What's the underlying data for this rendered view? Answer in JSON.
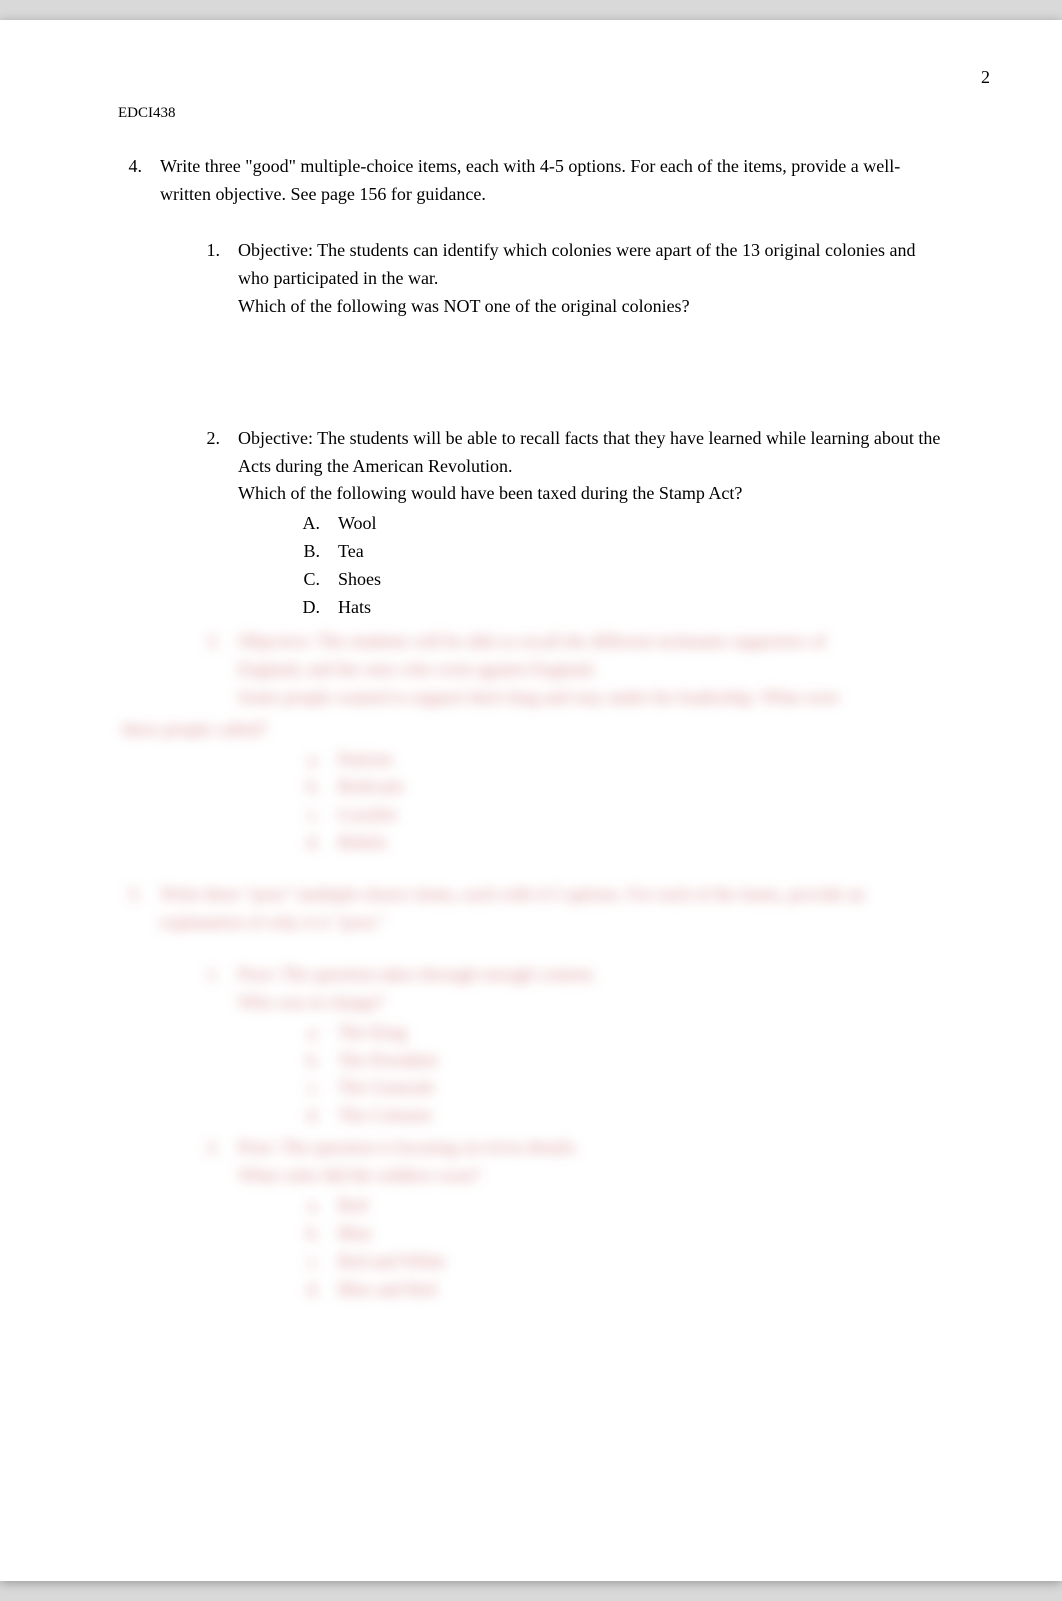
{
  "page_number": "2",
  "header_code": "EDCI438",
  "q4": {
    "number": "4.",
    "prompt": "Write three \"good\" multiple-choice items, each with 4-5 options. For each of the items, provide a well-written objective. See page 156 for guidance.",
    "items": [
      {
        "number": "1.",
        "objective": "Objective: The students can identify which colonies were apart of the 13 original colonies and who participated in the war.",
        "question": "Which of the following was NOT one of the original colonies?",
        "options": []
      },
      {
        "number": "2.",
        "objective": "Objective: The students will be able to recall facts that they have learned while learning about the Acts during the American Revolution.",
        "question": "Which of the following would have been taxed during the Stamp Act?",
        "options": [
          {
            "letter": "A.",
            "text": "Wool"
          },
          {
            "letter": "B.",
            "text": "Tea"
          },
          {
            "letter": "C.",
            "text": "Shoes"
          },
          {
            "letter": "D.",
            "text": "Hats"
          }
        ]
      }
    ],
    "blurred_item": {
      "number": "3.",
      "lines": [
        "Objective: The students will be able to recall the different nickname supporters of",
        "England, and the ones who went against England.",
        "    Some people wanted to support their king and stay under his leadership. What were"
      ],
      "hanging": "these people called?",
      "options": [
        {
          "letter": "a.",
          "text": "Patriots"
        },
        {
          "letter": "b.",
          "text": "Redcoats"
        },
        {
          "letter": "c.",
          "text": "Loyalist"
        },
        {
          "letter": "d.",
          "text": "Rebels"
        }
      ]
    }
  },
  "q5_blurred": {
    "number": "5.",
    "prompt": "Write three \"poor\" multiple-choice items, each with 4-5 options. For each of the items, provide an explanation of why it is \"poor.\"",
    "items": [
      {
        "number": "1.",
        "line1": "Poor: The question takes through enough content.",
        "line2": "Who was in charge?",
        "options": [
          {
            "letter": "a.",
            "text": "The King"
          },
          {
            "letter": "b.",
            "text": "The President"
          },
          {
            "letter": "c.",
            "text": "The Generals"
          },
          {
            "letter": "d.",
            "text": "The Colonist"
          }
        ]
      },
      {
        "number": "2.",
        "line1": "Poor: The question is focusing on trivia details.",
        "line2": "What color did the soldiers wear?",
        "options": [
          {
            "letter": "a.",
            "text": "Red"
          },
          {
            "letter": "b.",
            "text": "Blue"
          },
          {
            "letter": "c.",
            "text": "Red and White"
          },
          {
            "letter": "d.",
            "text": "Blue and Red"
          }
        ]
      }
    ]
  }
}
